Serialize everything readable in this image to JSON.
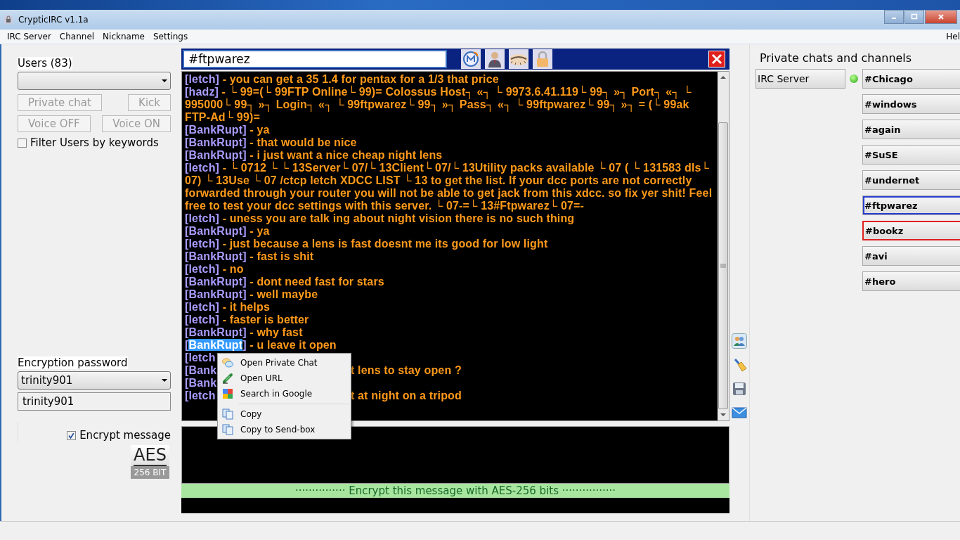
{
  "window": {
    "title": "CrypticIRC v1.1a"
  },
  "menu": [
    "IRC Server",
    "Channel",
    "Nickname",
    "Settings",
    "Hel"
  ],
  "users": {
    "label": "Users (83)",
    "buttons": [
      {
        "label": "Private chat",
        "disabled": true
      },
      {
        "label": "Kick",
        "disabled": true
      },
      {
        "label": "Voice OFF",
        "disabled": true
      },
      {
        "label": "Voice ON",
        "disabled": true
      }
    ],
    "filter": {
      "label": "Filter Users by keywords",
      "checked": false
    }
  },
  "encryption": {
    "label": "Encryption password",
    "selected_password": "trinity901",
    "password": "trinity901",
    "encrypt": {
      "label": "Encrypt message",
      "checked": true
    },
    "badge_top": "AES",
    "badge_bottom": "256 BIT"
  },
  "channel_bar": {
    "channel": "#ftpwarez"
  },
  "messages": [
    {
      "kind": "line",
      "nick": "[letch]",
      "text": "- you can get a 35 1.4 for pentax for a 1/3 that price",
      "selected": false
    },
    {
      "kind": "line",
      "nick": "[hadz]",
      "text": "- └ 99=(└ 99FTP Online└ 99)= Colossus Host┐ «┐ └ 9973.6.41.119└ 99┐ »┐  Port┐ «┐ └ 995000└ 99┐ »┐  Login┐ «┐ └ 99ftpwarez└ 99┐ »┐  Pass┐ «┐ └ 99ftpwarez└ 99┐ »┐  = (└ 99ak FTP-Ad└ 99)=",
      "selected": false
    },
    {
      "kind": "line",
      "nick": "[BankRupt]",
      "text": "- ya",
      "selected": false
    },
    {
      "kind": "line",
      "nick": "[BankRupt]",
      "text": "- that would be nice",
      "selected": false
    },
    {
      "kind": "line",
      "nick": "[BankRupt]",
      "text": "- i just want a nice cheap night lens",
      "selected": false
    },
    {
      "kind": "line",
      "nick": "[letch]",
      "text": "-    └ 0712   └  └ 13Server└ 07/└ 13Client└ 07/└ 13Utility packs available └ 07 (   └ 131583    dls└ 07) └ 13Use └ 07   /ctcp letch XDCC LIST    └ 13 to get the list. If your dcc ports are not correctly forwarded through your router you will not be able to get jack from this xdcc. so fix yer shit! Feel free to test your dcc settings with this server. └ 07-=└ 13#Ftpwarez└ 07=-",
      "selected": false
    },
    {
      "kind": "line",
      "nick": "[letch]",
      "text": "- uness you are talk ing about night vision there is no such thing",
      "selected": false
    },
    {
      "kind": "line",
      "nick": "[BankRupt]",
      "text": "- ya",
      "selected": false
    },
    {
      "kind": "line",
      "nick": "[letch]",
      "text": "- just because a lens is fast doesnt me its good for low light",
      "selected": false
    },
    {
      "kind": "line",
      "nick": "[BankRupt]",
      "text": "- fast is shit",
      "selected": false
    },
    {
      "kind": "line",
      "nick": "[letch]",
      "text": "- no",
      "selected": false
    },
    {
      "kind": "line",
      "nick": "[BankRupt]",
      "text": "- dont need fast for stars",
      "selected": false
    },
    {
      "kind": "line",
      "nick": "[BankRupt]",
      "text": "- well maybe",
      "selected": false
    },
    {
      "kind": "line",
      "nick": "[letch]",
      "text": "- it helps",
      "selected": false
    },
    {
      "kind": "line",
      "nick": "[letch]",
      "text": "- faster is better",
      "selected": false
    },
    {
      "kind": "line",
      "nick": "[BankRupt]",
      "text": "- why fast",
      "selected": false
    },
    {
      "kind": "line",
      "nick": "[BankRupt]",
      "text": "- u leave it open",
      "selected": true
    },
    {
      "kind": "covered",
      "fragment": "[letch"
    },
    {
      "kind": "covered",
      "fragment": "[Bank",
      "text": "t lens to stay open ?"
    },
    {
      "kind": "covered",
      "fragment": "[Bank"
    },
    {
      "kind": "covered",
      "fragment": "[letch",
      "text": "t at night on a tripod"
    }
  ],
  "context_menu": [
    {
      "kind": "item",
      "label": "Open Private Chat"
    },
    {
      "kind": "item",
      "label": "Open URL"
    },
    {
      "kind": "item",
      "label": "Search in Google"
    },
    {
      "kind": "separator"
    },
    {
      "kind": "item",
      "label": "Copy"
    },
    {
      "kind": "item",
      "label": "Copy to Send-box"
    }
  ],
  "input_bar": {
    "banner": "··············· Encrypt this message with AES-256 bits ················"
  },
  "channels_panel": {
    "title": "Private chats and channels",
    "server_button": "IRC Server",
    "connected": true,
    "channels": [
      {
        "name": "#Chicago",
        "selected": false,
        "alert": false
      },
      {
        "name": "#windows",
        "selected": false,
        "alert": false
      },
      {
        "name": "#again",
        "selected": false,
        "alert": false
      },
      {
        "name": "#SuSE",
        "selected": false,
        "alert": false
      },
      {
        "name": "#undernet",
        "selected": false,
        "alert": false
      },
      {
        "name": "#ftpwarez",
        "selected": true,
        "alert": false
      },
      {
        "name": "#bookz",
        "selected": false,
        "alert": true
      },
      {
        "name": "#avi",
        "selected": false,
        "alert": false
      },
      {
        "name": "#hero",
        "selected": false,
        "alert": false
      }
    ]
  }
}
